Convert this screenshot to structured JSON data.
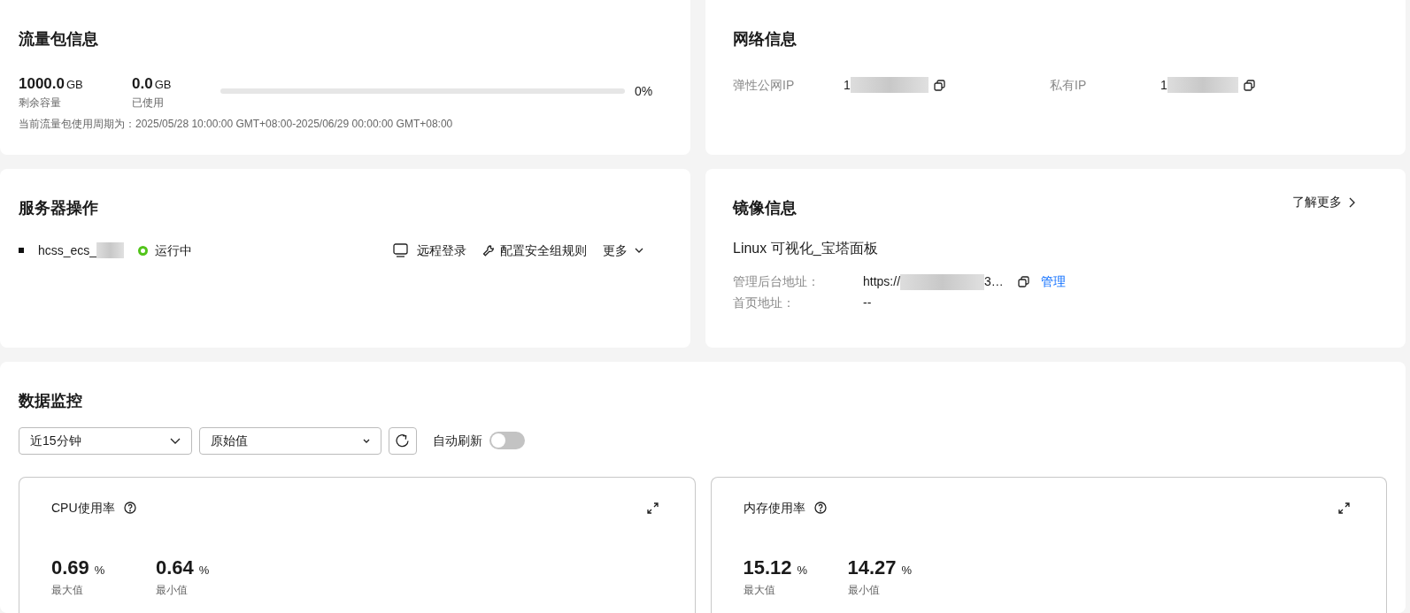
{
  "traffic": {
    "title": "流量包信息",
    "remaining": {
      "value": "1000.0",
      "unit": "GB",
      "label": "剩余容量"
    },
    "used": {
      "value": "0.0",
      "unit": "GB",
      "label": "已使用"
    },
    "usage": {
      "level": 0,
      "reading": "0%"
    },
    "period": "当前流量包使用周期为：2025/05/28 10:00:00 GMT+08:00-2025/06/29 00:00:00 GMT+08:00"
  },
  "network": {
    "title": "网络信息",
    "fields": [
      {
        "label": "弹性公网IP",
        "value": "1"
      },
      {
        "label": "私有IP",
        "value": "1"
      }
    ]
  },
  "server": {
    "title": "服务器操作",
    "name": "hcss_ecs_",
    "status": {
      "text": "运行中",
      "color": "#52c41a"
    },
    "actions": [
      {
        "kind": "monitor",
        "label": "远程登录"
      },
      {
        "kind": "wrench",
        "label": "配置安全组规则"
      },
      {
        "kind": "dropdown",
        "label": "更多"
      }
    ]
  },
  "image": {
    "title": "镜像信息",
    "more_link": "了解更多",
    "name": "Linux 可视化_宝塔面板",
    "fields": [
      {
        "label": "管理后台地址：",
        "value_start": "https://",
        "value_end": "3…",
        "link": "管理"
      },
      {
        "label": "首页地址：",
        "value_start": "--"
      }
    ]
  },
  "monitor": {
    "title": "数据监控",
    "selects": [
      {
        "value": "近15分钟"
      },
      {
        "value": "原始值"
      }
    ],
    "auto_refresh": {
      "label": "自动刷新",
      "on": false
    },
    "charts": [
      {
        "title": "CPU使用率",
        "stats": [
          {
            "value": "0.69",
            "unit": "%",
            "label": "最大值"
          },
          {
            "value": "0.64",
            "unit": "%",
            "label": "最小值"
          }
        ]
      },
      {
        "title": "内存使用率",
        "stats": [
          {
            "value": "15.12",
            "unit": "%",
            "label": "最大值"
          },
          {
            "value": "14.27",
            "unit": "%",
            "label": "最小值"
          }
        ]
      }
    ]
  }
}
